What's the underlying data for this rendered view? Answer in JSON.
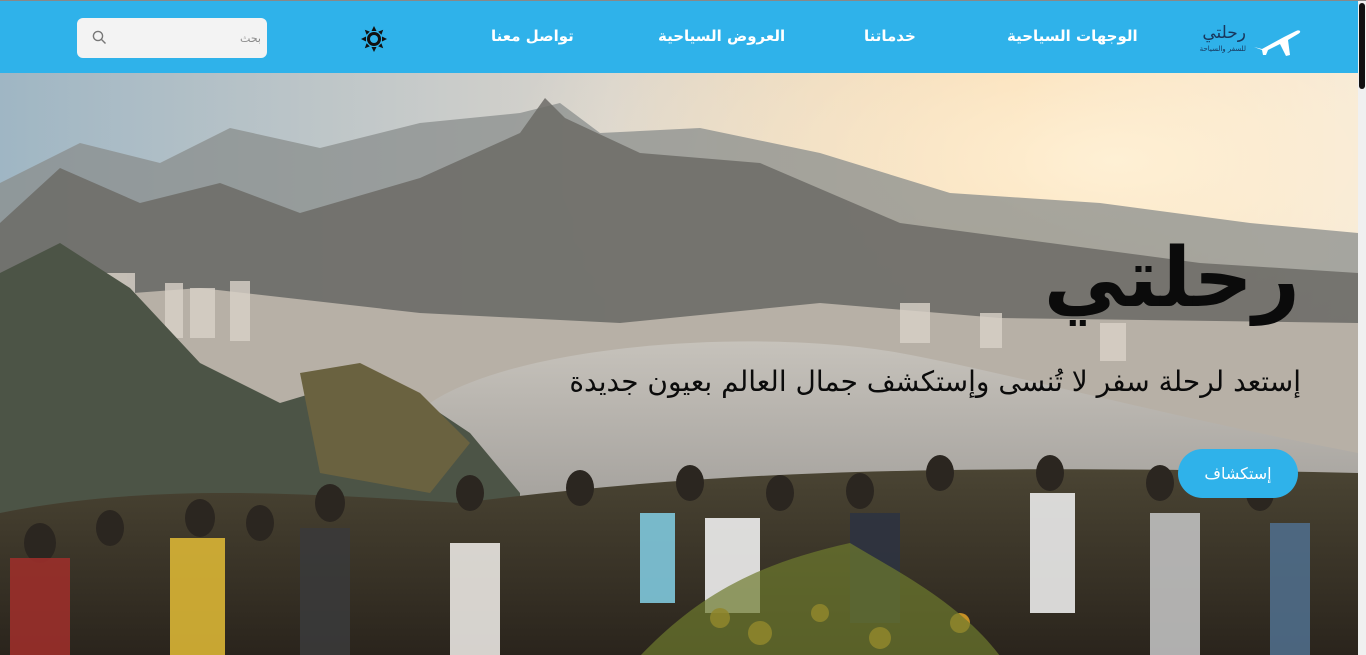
{
  "navbar": {
    "brand": {
      "name": "رحلتي",
      "tagline": "للسفر والسياحة"
    },
    "links": [
      {
        "label": "الوجهات السياحية"
      },
      {
        "label": "خدماتنا"
      },
      {
        "label": "العروض السياحية"
      },
      {
        "label": "تواصل معنا"
      }
    ],
    "search": {
      "placeholder": "بحث",
      "value": ""
    },
    "icons": {
      "brand": "airplane-icon",
      "theme": "sun-icon",
      "search": "search-icon"
    }
  },
  "hero": {
    "title": "رحلتي",
    "subtitle": "إستعد لرحلة سفر لا تُنسى وإستكشف جمال العالم بعيون جديدة",
    "cta_label": "إستكشاف"
  },
  "colors": {
    "accent": "#2fb2ea",
    "text": "#0b0b0b",
    "brand_text": "#18365c"
  }
}
